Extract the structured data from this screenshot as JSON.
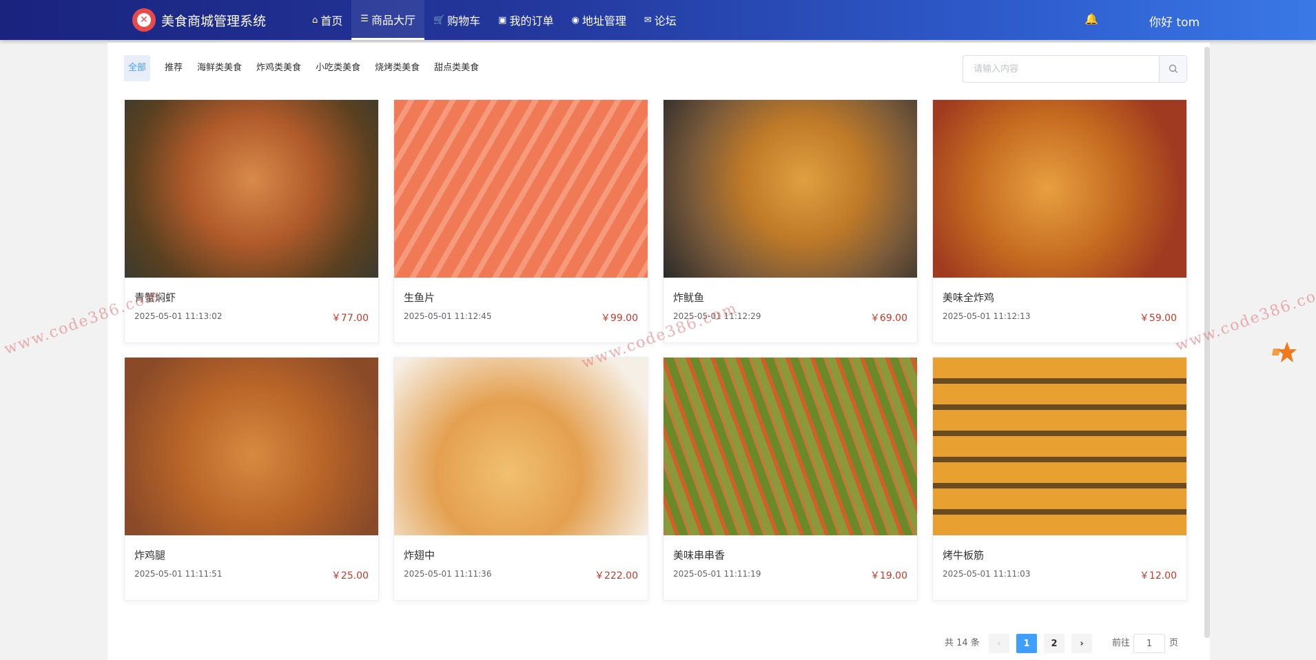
{
  "header": {
    "brand": "美食商城管理系统",
    "nav": [
      {
        "label": "首页",
        "icon": "home-icon",
        "glyph": "⌂"
      },
      {
        "label": "商品大厅",
        "icon": "list-icon",
        "glyph": "☰",
        "active": true
      },
      {
        "label": "购物车",
        "icon": "cart-icon",
        "glyph": "🛒"
      },
      {
        "label": "我的订单",
        "icon": "cc-icon",
        "glyph": "▣"
      },
      {
        "label": "地址管理",
        "icon": "eye-icon",
        "glyph": "◉"
      },
      {
        "label": "论坛",
        "icon": "mail-icon",
        "glyph": "✉"
      }
    ],
    "greeting": "你好 tom"
  },
  "categories": [
    "全部",
    "推荐",
    "海鲜类美食",
    "炸鸡类美食",
    "小吃类美食",
    "烧烤类美食",
    "甜点类美食"
  ],
  "search": {
    "placeholder": "请输入内容",
    "value": ""
  },
  "products": [
    {
      "name": "青蟹焖虾",
      "time": "2025-05-01 11:13:02",
      "price": "￥77.00"
    },
    {
      "name": "生鱼片",
      "time": "2025-05-01 11:12:45",
      "price": "￥99.00"
    },
    {
      "name": "炸鱿鱼",
      "time": "2025-05-01 11:12:29",
      "price": "￥69.00"
    },
    {
      "name": "美味全炸鸡",
      "time": "2025-05-01 11:12:13",
      "price": "￥59.00"
    },
    {
      "name": "炸鸡腿",
      "time": "2025-05-01 11:11:51",
      "price": "￥25.00"
    },
    {
      "name": "炸翅中",
      "time": "2025-05-01 11:11:36",
      "price": "￥222.00"
    },
    {
      "name": "美味串串香",
      "time": "2025-05-01 11:11:19",
      "price": "￥19.00"
    },
    {
      "name": "烤牛板筋",
      "time": "2025-05-01 11:11:03",
      "price": "￥12.00"
    }
  ],
  "pagination": {
    "total": "共 14 条",
    "pages": [
      "1",
      "2"
    ],
    "current": "1",
    "goto_prefix": "前往",
    "goto_value": "1",
    "goto_suffix": "页"
  },
  "watermark": "www.code386.com",
  "colors": {
    "accent": "#409eff",
    "price": "#c0392b",
    "header_start": "#1a237e",
    "header_end": "#3a79e6"
  }
}
